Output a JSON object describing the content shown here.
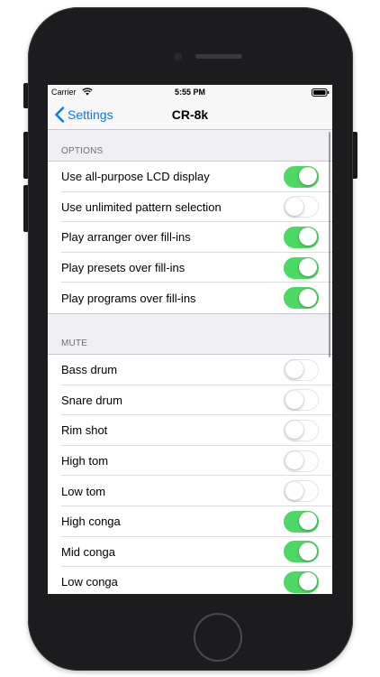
{
  "status_bar": {
    "carrier": "Carrier",
    "time": "5:55 PM",
    "wifi_icon": "wifi-icon",
    "battery_icon": "battery-icon"
  },
  "nav": {
    "back_label": "Settings",
    "back_icon": "chevron-left-icon",
    "title": "CR-8k"
  },
  "sections": {
    "options": {
      "header": "OPTIONS",
      "items": [
        {
          "label": "Use all-purpose LCD display",
          "on": true
        },
        {
          "label": "Use unlimited pattern selection",
          "on": false
        },
        {
          "label": "Play arranger over fill-ins",
          "on": true
        },
        {
          "label": "Play presets over fill-ins",
          "on": true
        },
        {
          "label": "Play programs over fill-ins",
          "on": true
        }
      ]
    },
    "mute": {
      "header": "MUTE",
      "items": [
        {
          "label": "Bass drum",
          "on": false
        },
        {
          "label": "Snare drum",
          "on": false
        },
        {
          "label": "Rim shot",
          "on": false
        },
        {
          "label": "High tom",
          "on": false
        },
        {
          "label": "Low tom",
          "on": false
        },
        {
          "label": "High conga",
          "on": true
        },
        {
          "label": "Mid conga",
          "on": true
        },
        {
          "label": "Low conga",
          "on": true
        }
      ]
    }
  },
  "colors": {
    "accent": "#007aff",
    "switch_on": "#4cd964",
    "background": "#efeff4"
  }
}
